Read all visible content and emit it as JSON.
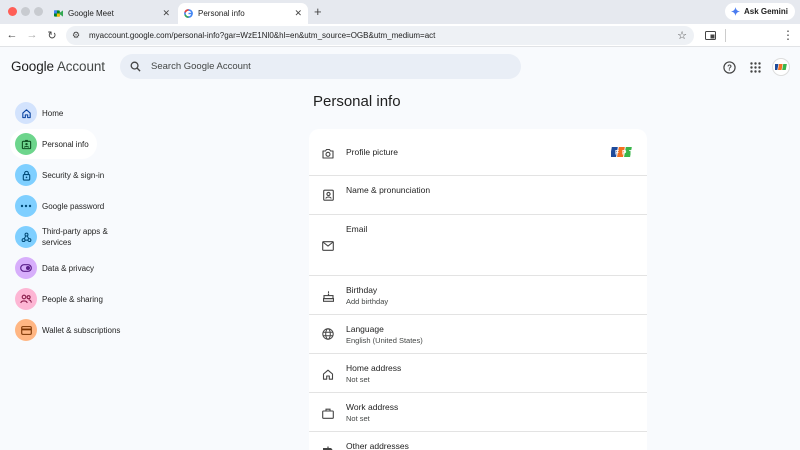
{
  "browser": {
    "tabs": [
      {
        "title": "Google Meet",
        "icon": "google-meet-icon",
        "active": false
      },
      {
        "title": "Personal info",
        "icon": "google-g-icon",
        "active": true
      }
    ],
    "ask_gemini": "Ask Gemini",
    "url": "myaccount.google.com/personal-info?gar=WzE1Nl0&hl=en&utm_source=OGB&utm_medium=act"
  },
  "header": {
    "logo_google": "Google",
    "logo_account": "Account",
    "search_placeholder": "Search Google Account"
  },
  "sidebar": {
    "items": [
      {
        "label": "Home",
        "icon": "home-icon",
        "color": "#d3e3fd"
      },
      {
        "label": "Personal info",
        "icon": "id-card-icon",
        "color": "#6dd58c",
        "selected": true
      },
      {
        "label": "Security & sign-in",
        "icon": "lock-icon",
        "color": "#7fcfff"
      },
      {
        "label": "Google password",
        "icon": "password-icon",
        "color": "#7fcfff"
      },
      {
        "label": "Third-party apps & services",
        "icon": "apps-icon",
        "color": "#7fcfff"
      },
      {
        "label": "Data & privacy",
        "icon": "toggle-icon",
        "color": "#d7aefb"
      },
      {
        "label": "People & sharing",
        "icon": "people-icon",
        "color": "#fdb6d4"
      },
      {
        "label": "Wallet & subscriptions",
        "icon": "wallet-icon",
        "color": "#ffb683"
      }
    ]
  },
  "main": {
    "title": "Personal info",
    "rows": [
      {
        "label": "Profile picture",
        "icon": "camera-icon",
        "value": ""
      },
      {
        "label": "Name & pronunciation",
        "icon": "badge-icon",
        "value": ""
      },
      {
        "label": "Email",
        "icon": "mail-icon",
        "value": ""
      },
      {
        "label": "Birthday",
        "icon": "cake-icon",
        "value": "Add birthday"
      },
      {
        "label": "Language",
        "icon": "globe-icon",
        "value": "English (United States)"
      },
      {
        "label": "Home address",
        "icon": "home-icon",
        "value": "Not set"
      },
      {
        "label": "Work address",
        "icon": "briefcase-icon",
        "value": "Not set"
      },
      {
        "label": "Other addresses",
        "icon": "signpost-icon",
        "value": ""
      }
    ]
  },
  "colors": {
    "accent": "#0b57d0",
    "page_bg": "#f8fafd",
    "fpt_orange": "#f37021",
    "fpt_blue": "#1e4b9b",
    "fpt_green": "#39b54a"
  }
}
